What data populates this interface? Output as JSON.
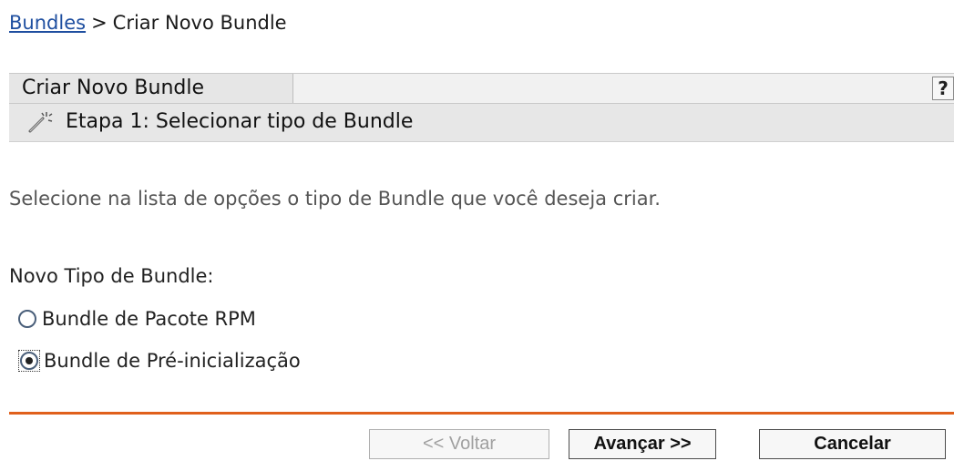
{
  "breadcrumb": {
    "link": "Bundles",
    "separator": ">",
    "current": "Criar Novo Bundle"
  },
  "panel": {
    "title": "Criar Novo Bundle",
    "help_label": "?",
    "step_title": "Etapa 1: Selecionar tipo de Bundle",
    "step_icon": "wand-icon"
  },
  "description": "Selecione na lista de opções o tipo de Bundle que você deseja criar.",
  "bundle_type": {
    "label": "Novo Tipo de Bundle:",
    "options": [
      {
        "label": "Bundle de Pacote RPM",
        "selected": false
      },
      {
        "label": "Bundle de Pré-inicialização",
        "selected": true
      }
    ]
  },
  "buttons": {
    "back": "<< Voltar",
    "next": "Avançar >>",
    "cancel": "Cancelar"
  },
  "colors": {
    "link": "#1f4fa0",
    "divider": "#e0601c"
  }
}
